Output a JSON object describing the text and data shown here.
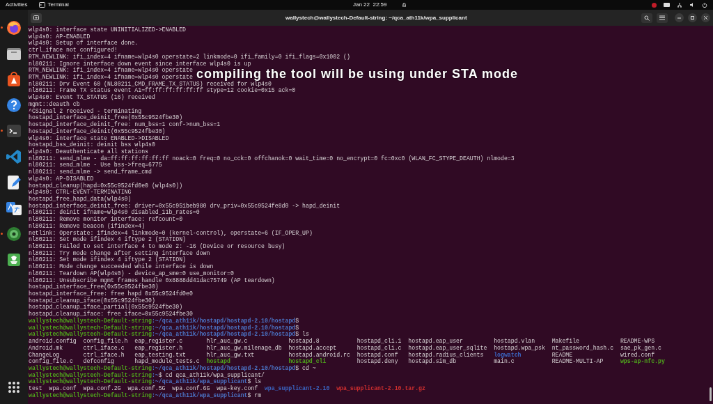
{
  "top_bar": {
    "activities": "Activities",
    "app_name": "Terminal",
    "clock": "Jan 22  22:59"
  },
  "dock": {
    "items": [
      {
        "kind": "browser",
        "running": true
      },
      {
        "kind": "files",
        "running": false
      },
      {
        "kind": "store",
        "running": false
      },
      {
        "kind": "help",
        "running": false
      },
      {
        "kind": "terminal",
        "running": true
      },
      {
        "kind": "code",
        "running": false
      },
      {
        "kind": "editor",
        "running": false
      },
      {
        "kind": "translate",
        "running": false
      },
      {
        "kind": "globe",
        "running": true
      },
      {
        "kind": "trash",
        "running": false
      }
    ]
  },
  "window": {
    "title": "wallystech@wallystech-Default-string: ~/qca_ath11k/wpa_supplicant"
  },
  "terminal": {
    "lines": [
      {
        "kind": "log",
        "text": "wlp4s0: interface state UNINITIALIZED->ENABLED"
      },
      {
        "kind": "log",
        "text": "wlp4s0: AP-ENABLED"
      },
      {
        "kind": "log",
        "text": "wlp4s0: Setup of interface done."
      },
      {
        "kind": "log",
        "text": "ctrl_iface not configured!"
      },
      {
        "kind": "log",
        "text": "RTM_NEWLINK: ifi_index=4 ifname=wlp4s0 operstate=2 linkmode=0 ifi_family=0 ifi_flags=0x1002 ()"
      },
      {
        "kind": "log",
        "text": "nl80211: Ignore interface down event since interface wlp4s0 is up"
      },
      {
        "kind": "log",
        "text": "RTM_NEWLINK: ifi_index=4 ifname=wlp4s0 operstate"
      },
      {
        "kind": "log",
        "text": "RTM_NEWLINK: ifi_index=4 ifname=wlp4s0 operstate"
      },
      {
        "kind": "log",
        "text": "nl80211: Drv Event 60 (NL80211_CMD_FRAME_TX_STATUS) received for wlp4s0"
      },
      {
        "kind": "log",
        "text": "nl80211: Frame TX status event A1=ff:ff:ff:ff:ff:ff stype=12 cookie=0x15 ack=0"
      },
      {
        "kind": "log",
        "text": "wlp4s0: Event TX_STATUS (16) received"
      },
      {
        "kind": "log",
        "text": "mgmt::deauth cb"
      },
      {
        "kind": "log",
        "text": "^CSignal 2 received - terminating"
      },
      {
        "kind": "log",
        "text": "hostapd_interface_deinit_free(0x55c9524fbe30)"
      },
      {
        "kind": "log",
        "text": "hostapd_interface_deinit_free: num_bss=1 conf->num_bss=1"
      },
      {
        "kind": "log",
        "text": "hostapd_interface_deinit(0x55c9524fbe30)"
      },
      {
        "kind": "log",
        "text": "wlp4s0: interface state ENABLED->DISABLED"
      },
      {
        "kind": "log",
        "text": "hostapd_bss_deinit: deinit bss wlp4s0"
      },
      {
        "kind": "log",
        "text": "wlp4s0: Deauthenticate all stations"
      },
      {
        "kind": "log",
        "text": "nl80211: send_mlme - da=ff:ff:ff:ff:ff:ff noack=0 freq=0 no_cck=0 offchanok=0 wait_time=0 no_encrypt=0 fc=0xc0 (WLAN_FC_STYPE_DEAUTH) nlmode=3"
      },
      {
        "kind": "log",
        "text": "nl80211: send_mlme - Use bss->freq=6775"
      },
      {
        "kind": "log",
        "text": "nl80211: send_mlme -> send_frame_cmd"
      },
      {
        "kind": "log",
        "text": "wlp4s0: AP-DISABLED"
      },
      {
        "kind": "log",
        "text": "hostapd_cleanup(hapd=0x55c9524fd0e0 (wlp4s0))"
      },
      {
        "kind": "log",
        "text": "wlp4s0: CTRL-EVENT-TERMINATING"
      },
      {
        "kind": "log",
        "text": "hostapd_free_hapd_data(wlp4s0)"
      },
      {
        "kind": "log",
        "text": "hostapd_interface_deinit_free: driver=0x55c951beb980 drv_priv=0x55c9524fe8d0 -> hapd_deinit"
      },
      {
        "kind": "log",
        "text": "nl80211: deinit ifname=wlp4s0 disabled_11b_rates=0"
      },
      {
        "kind": "log",
        "text": "nl80211: Remove monitor interface: refcount=0"
      },
      {
        "kind": "log",
        "text": "nl80211: Remove beacon (ifindex=4)"
      },
      {
        "kind": "log",
        "text": "netlink: Operstate: ifindex=4 linkmode=0 (kernel-control), operstate=6 (IF_OPER_UP)"
      },
      {
        "kind": "log",
        "text": "nl80211: Set mode ifindex 4 iftype 2 (STATION)"
      },
      {
        "kind": "log",
        "text": "nl80211: Failed to set interface 4 to mode 2: -16 (Device or resource busy)"
      },
      {
        "kind": "log",
        "text": "nl80211: Try mode change after setting interface down"
      },
      {
        "kind": "log",
        "text": "nl80211: Set mode ifindex 4 iftype 2 (STATION)"
      },
      {
        "kind": "log",
        "text": "nl80211: Mode change succeeded while interface is down"
      },
      {
        "kind": "log",
        "text": "nl80211: Teardown AP(wlp4s0) - device_ap_sme=0 use_monitor=0"
      },
      {
        "kind": "log",
        "text": "nl80211: Unsubscribe mgmt frames handle 0x8888dd41dac75749 (AP teardown)"
      },
      {
        "kind": "log",
        "text": "hostapd_interface_free(0x55c9524fbe30)"
      },
      {
        "kind": "log",
        "text": "hostapd_interface_free: free hapd 0x55c9524fd0e0"
      },
      {
        "kind": "log",
        "text": "hostapd_cleanup_iface(0x55c9524fbe30)"
      },
      {
        "kind": "log",
        "text": "hostapd_cleanup_iface_partial(0x55c9524fbe30)"
      },
      {
        "kind": "log",
        "text": "hostapd_cleanup_iface: free iface=0x55c9524fbe30"
      },
      {
        "kind": "prompt",
        "user": "wallystech@wallystech-Default-string",
        "path": ":~/qca_ath11k/hostapd/hostapd-2.10/hostapd",
        "command": "$"
      },
      {
        "kind": "prompt",
        "user": "wallystech@wallystech-Default-string",
        "path": ":~/qca_ath11k/hostapd/hostapd-2.10/hostapd",
        "command": "$"
      },
      {
        "kind": "prompt",
        "user": "wallystech@wallystech-Default-string",
        "path": ":~/qca_ath11k/hostapd/hostapd-2.10/hostapd",
        "command": "$ ls"
      },
      {
        "kind": "ls_table",
        "rows": [
          [
            {
              "name": "android.config"
            },
            {
              "name": "config_file.h"
            },
            {
              "name": "eap_register.c"
            },
            {
              "name": "hlr_auc_gw.c"
            },
            {
              "name": "hostapd.8"
            },
            {
              "name": "hostapd_cli.1"
            },
            {
              "name": "hostapd.eap_user"
            },
            {
              "name": "hostapd.vlan"
            },
            {
              "name": "Makefile"
            },
            {
              "name": "README-WPS"
            }
          ],
          [
            {
              "name": "Android.mk"
            },
            {
              "name": "ctrl_iface.c"
            },
            {
              "name": "eap_register.h"
            },
            {
              "name": "hlr_auc_gw.milenage_db"
            },
            {
              "name": "hostapd.accept"
            },
            {
              "name": "hostapd_cli.c"
            },
            {
              "name": "hostapd.eap_user_sqlite"
            },
            {
              "name": "hostapd.wpa_psk"
            },
            {
              "name": "nt_password_hash.c"
            },
            {
              "name": "sae_pk_gen.c"
            }
          ],
          [
            {
              "name": "ChangeLog"
            },
            {
              "name": "ctrl_iface.h"
            },
            {
              "name": "eap_testing.txt"
            },
            {
              "name": "hlr_auc_gw.txt"
            },
            {
              "name": "hostapd.android.rc"
            },
            {
              "name": "hostapd.conf"
            },
            {
              "name": "hostapd.radius_clients"
            },
            {
              "name": "logwatch",
              "color": "#3b66c4"
            },
            {
              "name": "README"
            },
            {
              "name": "wired.conf"
            }
          ],
          [
            {
              "name": "config_file.c"
            },
            {
              "name": "defconfig"
            },
            {
              "name": "hapd_module_tests.c"
            },
            {
              "name": "hostapd",
              "color": "#4fa61c"
            },
            {
              "name": "hostapd_cli",
              "color": "#4fa61c"
            },
            {
              "name": "hostapd.deny"
            },
            {
              "name": "hostapd.sim_db"
            },
            {
              "name": "main.c"
            },
            {
              "name": "README-MULTI-AP"
            },
            {
              "name": "wps-ap-nfc.py",
              "color": "#4fa61c"
            }
          ]
        ]
      },
      {
        "kind": "prompt",
        "user": "wallystech@wallystech-Default-string",
        "path": ":~/qca_ath11k/hostapd/hostapd-2.10/hostapd",
        "command": "$ cd ~"
      },
      {
        "kind": "prompt",
        "user": "wallystech@wallystech-Default-string",
        "path": ":~",
        "command": "$ cd qca_ath11k/wpa_supplicant/"
      },
      {
        "kind": "prompt",
        "user": "wallystech@wallystech-Default-string",
        "path": ":~/qca_ath11k/wpa_supplicant",
        "command": "$ ls"
      },
      {
        "kind": "ls_inline",
        "items": [
          {
            "name": "test"
          },
          {
            "name": "wpa.conf"
          },
          {
            "name": "wpa.conf.2G"
          },
          {
            "name": "wpa.conf.5G"
          },
          {
            "name": "wpa.conf.6G"
          },
          {
            "name": "wpa-key.conf"
          },
          {
            "name": "wpa_supplicant-2.10",
            "color": "#3b66c4"
          },
          {
            "name": "wpa_supplicant-2.10.tar.gz",
            "color": "#d02f2f"
          }
        ]
      },
      {
        "kind": "prompt",
        "user": "wallystech@wallystech-Default-string",
        "path": ":~/qca_ath11k/wpa_supplicant",
        "command": "$ rm"
      }
    ]
  },
  "caption": {
    "text": "compiling the tool will be using under STA mode"
  }
}
